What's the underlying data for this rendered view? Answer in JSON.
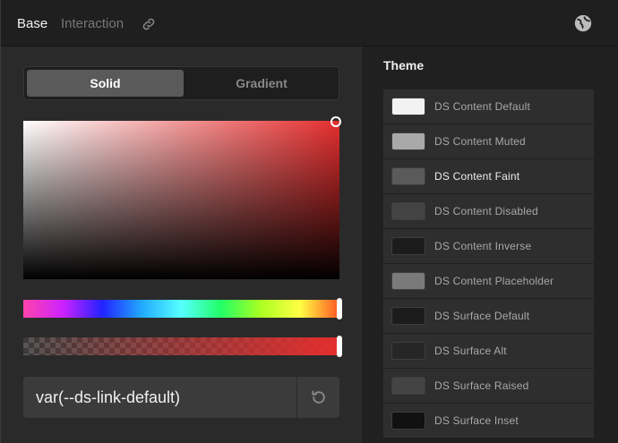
{
  "header": {
    "tabs": [
      {
        "label": "Base",
        "active": true
      },
      {
        "label": "Interaction",
        "active": false
      }
    ],
    "icons": [
      "link-icon",
      "globe-icon"
    ]
  },
  "mode_toggle": {
    "solid_label": "Solid",
    "gradient_label": "Gradient",
    "selected": "Solid"
  },
  "picker": {
    "base_color": "#e52e2e",
    "hue_level": 1.0,
    "alpha_level": 1.0
  },
  "value_input": {
    "value": "var(--ds-link-default)"
  },
  "theme": {
    "title": "Theme",
    "items": [
      {
        "label": "DS Content Default",
        "color": "#f2f2f2"
      },
      {
        "label": "DS Content Muted",
        "color": "#a9a9a9"
      },
      {
        "label": "DS Content Faint",
        "color": "#5a5a5a",
        "active": true
      },
      {
        "label": "DS Content Disabled",
        "color": "#444444"
      },
      {
        "label": "DS Content Inverse",
        "color": "#1c1c1c"
      },
      {
        "label": "DS Content Placeholder",
        "color": "#7a7a7a"
      },
      {
        "label": "DS Surface Default",
        "color": "#1c1c1c"
      },
      {
        "label": "DS Surface Alt",
        "color": "#262626"
      },
      {
        "label": "DS Surface Raised",
        "color": "#444444"
      },
      {
        "label": "DS Surface Inset",
        "color": "#111111"
      }
    ]
  }
}
